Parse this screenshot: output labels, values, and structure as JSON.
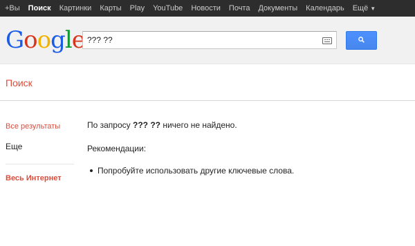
{
  "topnav": {
    "items": [
      "+Вы",
      "Поиск",
      "Картинки",
      "Карты",
      "Play",
      "YouTube",
      "Новости",
      "Почта",
      "Документы",
      "Календарь",
      "Ещё"
    ]
  },
  "header": {
    "logo_text": "Google",
    "search_value": "??? ??"
  },
  "page": {
    "title": "Поиск"
  },
  "sidebar": {
    "all_results": "Все результаты",
    "more": "Еще",
    "whole_web": "Весь Интернет"
  },
  "main": {
    "msg_prefix": "По запросу",
    "query": "??? ??",
    "msg_suffix": "ничего не найдено.",
    "recommendations_heading": "Рекомендации:",
    "suggestions": [
      "Попробуйте использовать другие ключевые слова."
    ]
  },
  "colors": {
    "accent_red": "#dd4b39",
    "button_blue": "#4d90fe",
    "topbar": "#2d2d2d"
  }
}
